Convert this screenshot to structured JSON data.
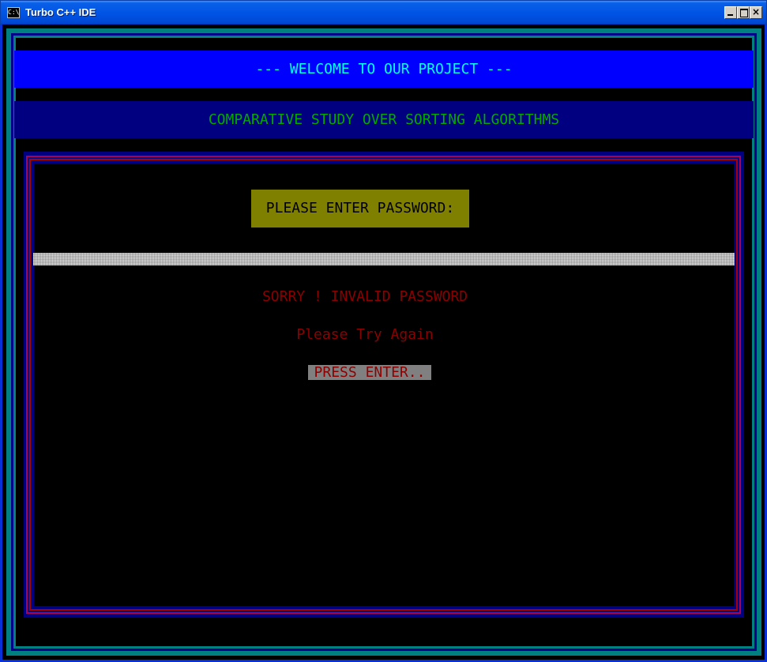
{
  "window": {
    "title": "Turbo C++ IDE",
    "icon_label": "C:\\",
    "controls": {
      "minimize": "",
      "maximize": "",
      "close": "×"
    }
  },
  "screen": {
    "welcome_banner": "--- WELCOME TO OUR PROJECT ---",
    "subtitle": "COMPARATIVE STUDY OVER SORTING ALGORITHMS",
    "password_prompt": "PLEASE ENTER PASSWORD:",
    "password_value": "",
    "error_message": "SORRY ! INVALID PASSWORD",
    "retry_message": "Please Try Again",
    "press_enter": "PRESS ENTER.."
  },
  "colors": {
    "titlebar": "#0055e5",
    "welcome_bg": "#0000ff",
    "welcome_text": "#00ffff",
    "subtitle_bg": "#000080",
    "subtitle_text": "#00aa00",
    "prompt_bg": "#808000",
    "error_text": "#8b0000",
    "border_cyan": "#008080"
  }
}
